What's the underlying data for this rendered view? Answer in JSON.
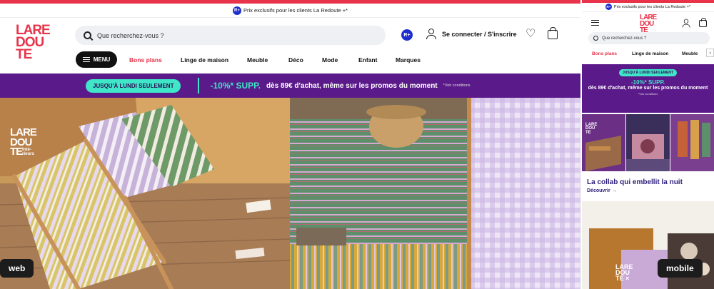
{
  "colors": {
    "brand": "#e8334a",
    "purple": "#5b1a8a",
    "mint": "#3fe6c8",
    "navy": "#2b1e78"
  },
  "promo_strip": {
    "badge": "R+",
    "text": "Prix exclusifs pour les clients La Redoute +*"
  },
  "logo": {
    "line1": "LARE",
    "line2": "DOU",
    "line3": "TE"
  },
  "web": {
    "search_placeholder": "Que recherchez-vous ?",
    "rplus_badge": "R+",
    "login": "Se connecter / S'inscrire",
    "menu_label": "MENU",
    "nav": [
      "Bons plans",
      "Linge de maison",
      "Meuble",
      "Déco",
      "Mode",
      "Enfant",
      "Marques"
    ],
    "banner": {
      "pill": "JUSQU'À LUNDI SEULEMENT",
      "pct": "-10%* SUPP.",
      "text": "dès 89€ d'achat, même sur les promos du moment",
      "cond": "*Voir conditions"
    },
    "hero_logo": {
      "line1": "LARE",
      "line2": "DOU",
      "line3": "TE",
      "sub1": "Inté-",
      "sub2": "rieurs"
    },
    "tag": "web"
  },
  "mobile": {
    "search_placeholder": "Que recherchez-vous ?",
    "nav": [
      "Bons plans",
      "Linge de maison",
      "Meuble"
    ],
    "banner": {
      "pill": "JUSQU'À LUNDI SEULEMENT",
      "pct": "-10%* SUPP.",
      "text": "dès 89€ d'achat, même sur les promos du moment",
      "cond": "*Voir conditions"
    },
    "collab_title": "La collab qui embellit la nuit",
    "discover": "Découvrir →",
    "collab_x": "×",
    "tag": "mobile"
  }
}
